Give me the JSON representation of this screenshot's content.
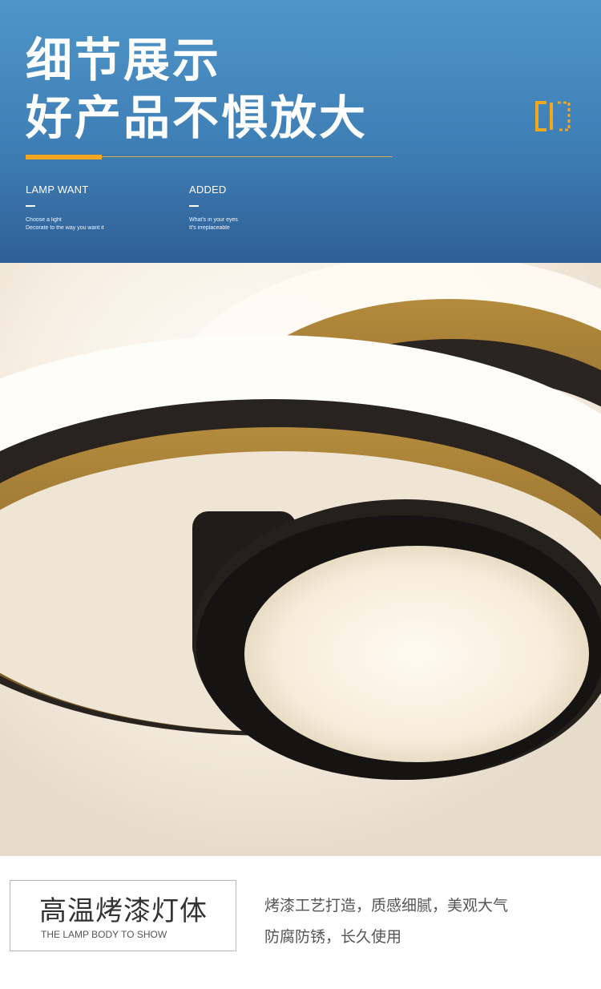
{
  "header": {
    "title_line1": "细节展示",
    "title_line2": "好产品不惧放大",
    "columns": [
      {
        "heading": "LAMP WANT",
        "line1": "Choose a light",
        "line2": "Decorate to the way you want it"
      },
      {
        "heading": "ADDED",
        "line1": "What's in your eyes",
        "line2": "It's irreplaceable"
      }
    ],
    "logo_icon": "bracket-logo-icon",
    "accent_color": "#f2a81e"
  },
  "photo": {
    "subject": "lamp-rings-icon"
  },
  "feature": {
    "label_cn": "高温烤漆灯体",
    "label_en": "THE LAMP BODY TO SHOW",
    "description_line1": "烤漆工艺打造，质感细腻，美观大气",
    "description_line2": "防腐防锈，长久使用"
  }
}
